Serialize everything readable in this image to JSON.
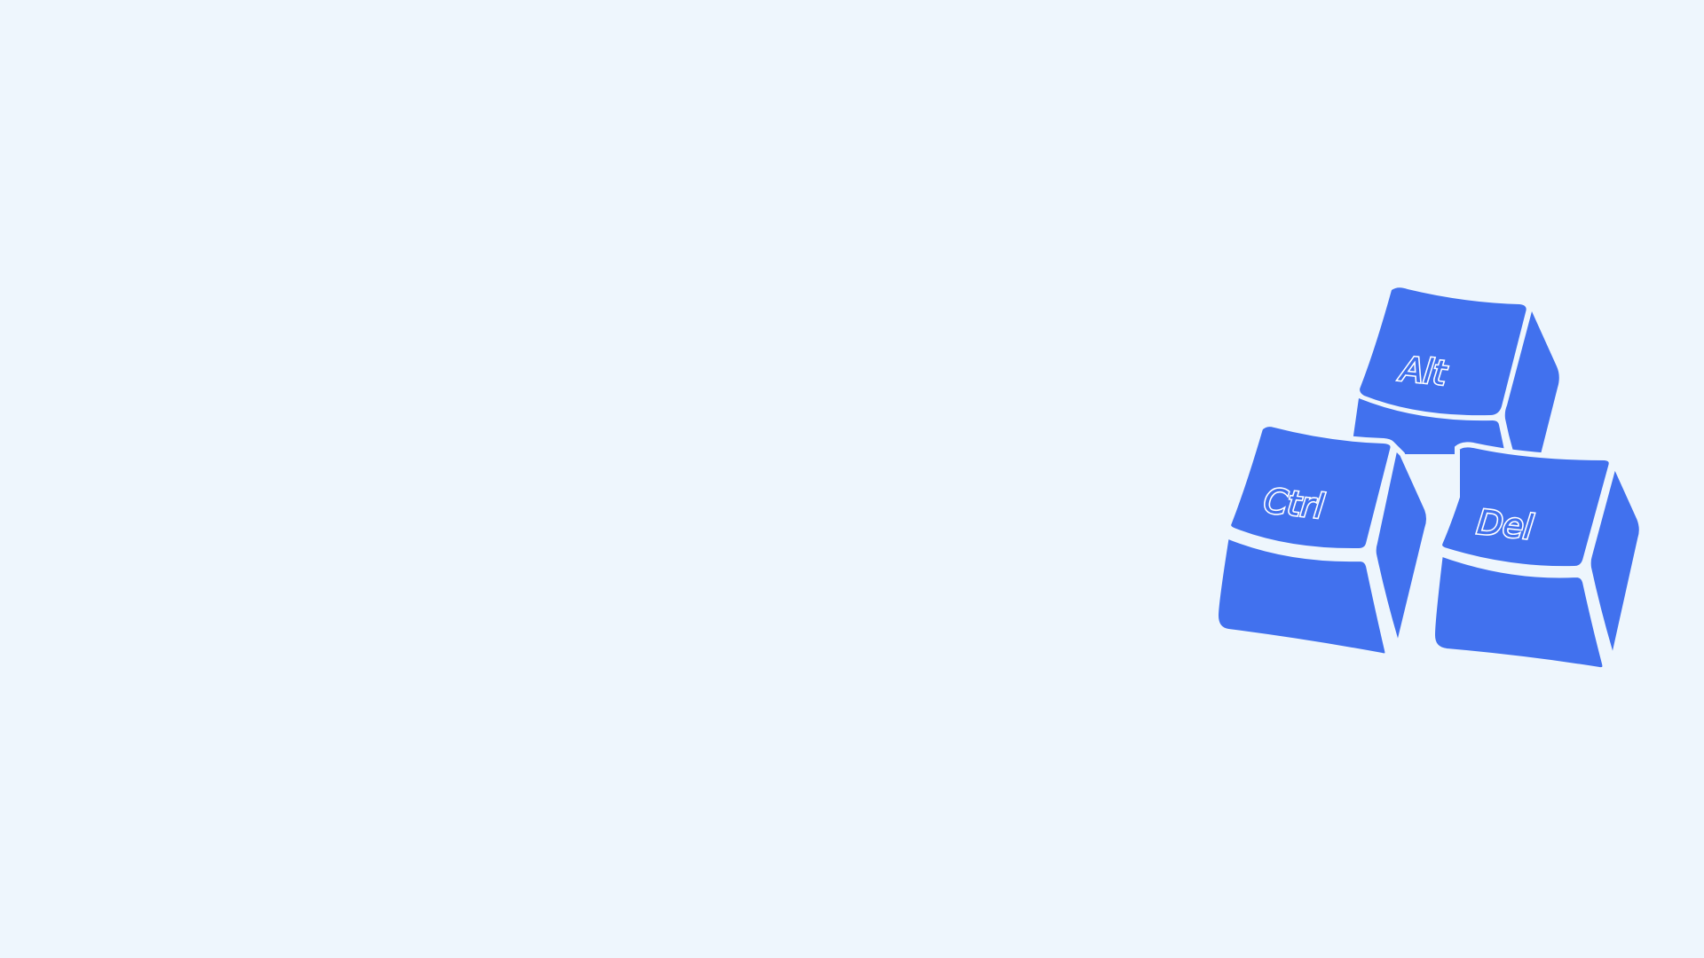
{
  "colors": {
    "background": "#eef6fd",
    "key_fill": "#4171ee",
    "key_gap": "#eef6fd"
  },
  "keys": {
    "alt": {
      "label": "Alt",
      "icon": "alt-keycap-icon"
    },
    "ctrl": {
      "label": "Ctrl",
      "icon": "ctrl-keycap-icon"
    },
    "del": {
      "label": "Del",
      "icon": "del-keycap-icon"
    }
  }
}
